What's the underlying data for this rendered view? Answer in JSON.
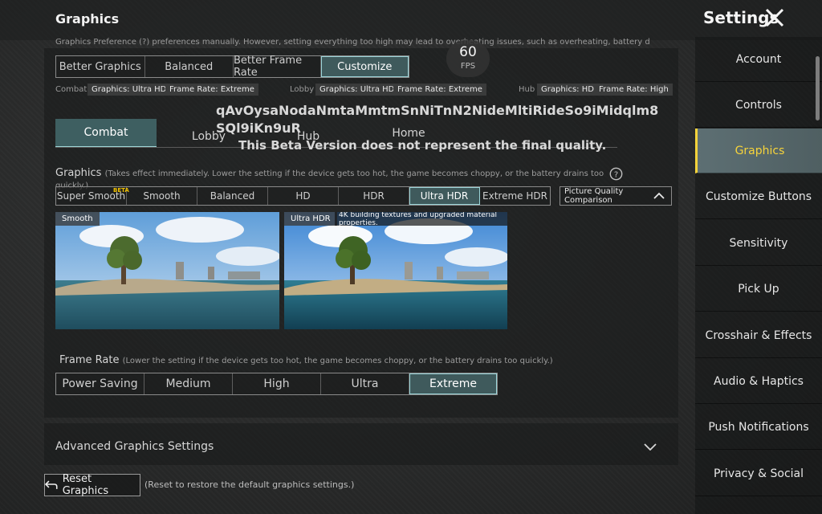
{
  "header": {
    "title": "Graphics",
    "settings_title": "Settings",
    "preface_text": "Graphics Preference (?) preferences manually. However, setting everything too high may lead to overheating issues, such as overheating, battery d"
  },
  "fps": {
    "value": "60",
    "unit": "FPS"
  },
  "preference": {
    "options": [
      "Better Graphics",
      "Balanced",
      "Better Frame Rate",
      "Customize"
    ],
    "selected": 3
  },
  "summaries": {
    "combat": {
      "label": "Combat",
      "graphics": "Graphics: Ultra HD",
      "framerate": "Frame Rate: Extreme"
    },
    "lobby": {
      "label": "Lobby",
      "graphics": "Graphics: Ultra HD",
      "framerate": "Frame Rate: Extreme"
    },
    "hub": {
      "label": "Hub",
      "graphics": "Graphics: HD",
      "framerate": "Frame Rate: High"
    }
  },
  "watermark": {
    "line1": "qAvOysaNodaNmtaMmtmSnNiTnN2NideMltiRideSo9iMidqlm8",
    "line2": "SQl9iKn9uR",
    "line3": "This Beta Version does not represent the final quality."
  },
  "tabs": [
    "Combat",
    "Lobby",
    "Hub",
    "Home"
  ],
  "graphics_section": {
    "label": "Graphics",
    "note": "(Takes effect immediately. Lower the setting if the device gets too hot, the game becomes choppy, or the battery drains too quickly.)",
    "options": [
      "Super Smooth",
      "Smooth",
      "Balanced",
      "HD",
      "HDR",
      "Ultra HDR",
      "Extreme HDR"
    ],
    "beta_tag": "BETA",
    "compare_label": "Picture Quality Comparison"
  },
  "preview": {
    "left_caption": "Smooth",
    "right_caption": "Ultra HDR",
    "right_note": "4K building textures and upgraded material properties."
  },
  "framerate_section": {
    "label": "Frame Rate",
    "note": "(Lower the setting if the device gets too hot, the game becomes choppy, or the battery drains too quickly.)",
    "options": [
      "Power Saving",
      "Medium",
      "High",
      "Ultra",
      "Extreme"
    ]
  },
  "advanced": {
    "label": "Advanced Graphics Settings"
  },
  "reset": {
    "label": "Reset Graphics",
    "note": "(Reset to restore the default graphics settings.)"
  },
  "sidebar": {
    "items": [
      {
        "label": "Account"
      },
      {
        "label": "Controls"
      },
      {
        "label": "Graphics"
      },
      {
        "label": "Customize Buttons"
      },
      {
        "label": "Sensitivity"
      },
      {
        "label": "Pick Up"
      },
      {
        "label": "Crosshair & Effects"
      },
      {
        "label": "Audio & Haptics"
      },
      {
        "label": "Push Notifications"
      },
      {
        "label": "Privacy & Social"
      }
    ],
    "active_color": "#f6d33b"
  },
  "colors": {
    "selected_bg": "#3f5a5c",
    "selected_outline": "#9bd4d8"
  }
}
